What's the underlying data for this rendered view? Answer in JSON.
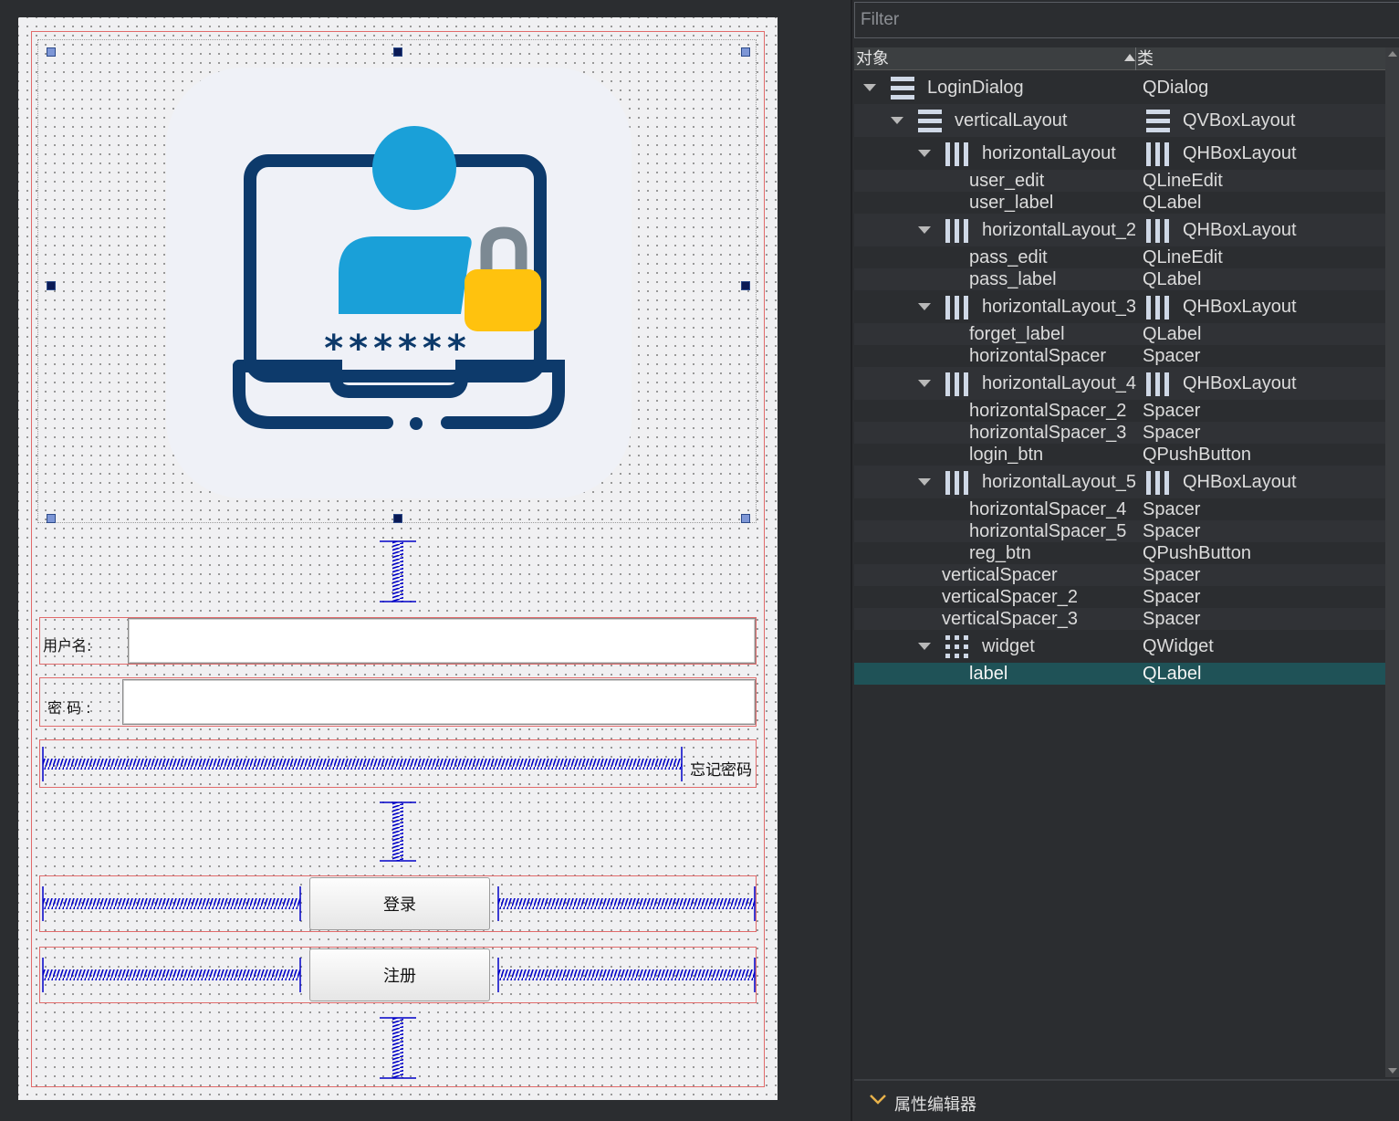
{
  "form": {
    "labels": {
      "user": "用户名:",
      "pass": "密 码 :",
      "forget": "忘记密码"
    },
    "buttons": {
      "login": "登录",
      "register": "注册"
    },
    "logo": {
      "stars": "******"
    },
    "colors": {
      "layout_box": "#e26b6b",
      "spacer": "#0000c8",
      "logo_navy": "#0d3a6b",
      "logo_blue": "#1aa0d8",
      "logo_yellow": "#ffc20e"
    }
  },
  "inspector": {
    "filter_placeholder": "Filter",
    "headers": {
      "object": "对象",
      "class": "类"
    },
    "rows": [
      {
        "object": "LoginDialog",
        "class": "QDialog"
      },
      {
        "object": "verticalLayout",
        "class": "QVBoxLayout"
      },
      {
        "object": "horizontalLayout",
        "class": "QHBoxLayout"
      },
      {
        "object": "user_edit",
        "class": "QLineEdit"
      },
      {
        "object": "user_label",
        "class": "QLabel"
      },
      {
        "object": "horizontalLayout_2",
        "class": "QHBoxLayout"
      },
      {
        "object": "pass_edit",
        "class": "QLineEdit"
      },
      {
        "object": "pass_label",
        "class": "QLabel"
      },
      {
        "object": "horizontalLayout_3",
        "class": "QHBoxLayout"
      },
      {
        "object": "forget_label",
        "class": "QLabel"
      },
      {
        "object": "horizontalSpacer",
        "class": "Spacer"
      },
      {
        "object": "horizontalLayout_4",
        "class": "QHBoxLayout"
      },
      {
        "object": "horizontalSpacer_2",
        "class": "Spacer"
      },
      {
        "object": "horizontalSpacer_3",
        "class": "Spacer"
      },
      {
        "object": "login_btn",
        "class": "QPushButton"
      },
      {
        "object": "horizontalLayout_5",
        "class": "QHBoxLayout"
      },
      {
        "object": "horizontalSpacer_4",
        "class": "Spacer"
      },
      {
        "object": "horizontalSpacer_5",
        "class": "Spacer"
      },
      {
        "object": "reg_btn",
        "class": "QPushButton"
      },
      {
        "object": "verticalSpacer",
        "class": "Spacer"
      },
      {
        "object": "verticalSpacer_2",
        "class": "Spacer"
      },
      {
        "object": "verticalSpacer_3",
        "class": "Spacer"
      },
      {
        "object": "widget",
        "class": "QWidget"
      },
      {
        "object": "label",
        "class": "QLabel",
        "selected": true
      }
    ],
    "icons": [
      "vbox-layout-icon",
      "hbox-layout-icon",
      "grid-layout-icon"
    ],
    "property_editor": "属性编辑器",
    "selection_color": "#1f5257"
  }
}
